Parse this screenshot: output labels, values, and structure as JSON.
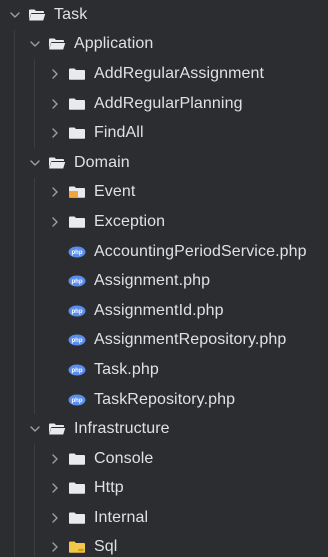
{
  "tree": {
    "root": {
      "label": "Task",
      "expanded": true,
      "icon": "folder-open-icon"
    },
    "items": [
      {
        "label": "Application",
        "depth": 1,
        "kind": "folder",
        "expanded": true,
        "icon": "folder-open-icon"
      },
      {
        "label": "AddRegularAssignment",
        "depth": 2,
        "kind": "folder",
        "expanded": false,
        "icon": "folder-icon"
      },
      {
        "label": "AddRegularPlanning",
        "depth": 2,
        "kind": "folder",
        "expanded": false,
        "icon": "folder-icon"
      },
      {
        "label": "FindAll",
        "depth": 2,
        "kind": "folder",
        "expanded": false,
        "icon": "folder-icon"
      },
      {
        "label": "Domain",
        "depth": 1,
        "kind": "folder",
        "expanded": true,
        "icon": "folder-open-icon"
      },
      {
        "label": "Event",
        "depth": 2,
        "kind": "folder",
        "expanded": false,
        "icon": "event-folder-icon"
      },
      {
        "label": "Exception",
        "depth": 2,
        "kind": "folder",
        "expanded": false,
        "icon": "folder-icon"
      },
      {
        "label": "AccountingPeriodService.php",
        "depth": 2,
        "kind": "file",
        "icon": "php-file-icon"
      },
      {
        "label": "Assignment.php",
        "depth": 2,
        "kind": "file",
        "icon": "php-file-icon"
      },
      {
        "label": "AssignmentId.php",
        "depth": 2,
        "kind": "file",
        "icon": "php-file-icon"
      },
      {
        "label": "AssignmentRepository.php",
        "depth": 2,
        "kind": "file",
        "icon": "php-file-icon"
      },
      {
        "label": "Task.php",
        "depth": 2,
        "kind": "file",
        "icon": "php-file-icon"
      },
      {
        "label": "TaskRepository.php",
        "depth": 2,
        "kind": "file",
        "icon": "php-file-icon"
      },
      {
        "label": "Infrastructure",
        "depth": 1,
        "kind": "folder",
        "expanded": true,
        "icon": "folder-open-icon"
      },
      {
        "label": "Console",
        "depth": 2,
        "kind": "folder",
        "expanded": false,
        "icon": "folder-icon"
      },
      {
        "label": "Http",
        "depth": 2,
        "kind": "folder",
        "expanded": false,
        "icon": "folder-icon"
      },
      {
        "label": "Internal",
        "depth": 2,
        "kind": "folder",
        "expanded": false,
        "icon": "folder-icon"
      },
      {
        "label": "Sql",
        "depth": 2,
        "kind": "folder",
        "expanded": false,
        "icon": "sql-folder-icon"
      }
    ],
    "php_badge": "php"
  },
  "colors": {
    "background": "#2b2d30",
    "text": "#dfe1e5",
    "folder": "#e8eaed",
    "chevron": "#9aa0a6",
    "php_file": "#5b8def",
    "event_folder_accent": "#f0a43a",
    "sql_folder": "#f2c84b"
  }
}
